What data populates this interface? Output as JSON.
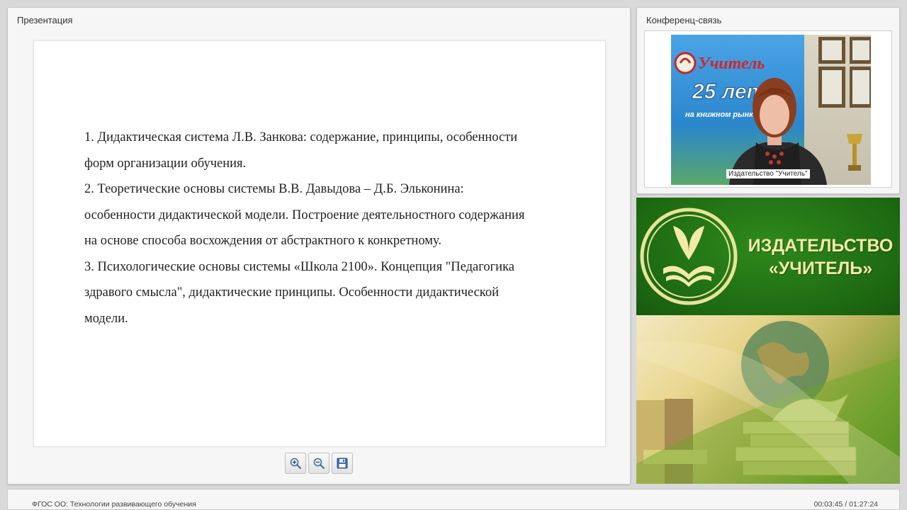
{
  "presentation": {
    "title": "Презентация",
    "slide": {
      "lines": [
        "1. Дидактическая система Л.В. Занкова: содержание, принципы, особенности",
        "форм организации обучения.",
        "2. Теоретические основы системы В.В. Давыдова – Д.Б. Эльконина:",
        "особенности дидактической модели. Построение деятельностного содержания",
        "на основе способа восхождения от абстрактного к конкретному.",
        "3. Психологические основы системы «Школа 2100». Концепция \"Педагогика",
        "здравого смысла\", дидактические принципы. Особенности дидактической",
        "модели."
      ]
    },
    "toolbar": {
      "zoom_in_icon": "zoom-in-icon",
      "zoom_out_icon": "zoom-out-icon",
      "save_icon": "floppy-disk-icon"
    }
  },
  "conference": {
    "title": "Конференц-связь",
    "speaker_label": "Издательство \"Учитель\"",
    "backdrop": {
      "logo_text": "Учитель",
      "years_text": "25 лет",
      "subtitle_text": "на книжном рынке России"
    }
  },
  "banner": {
    "publisher_line1": "ИЗДАТЕЛЬСТВО",
    "publisher_line2": "«УЧИТЕЛЬ»",
    "logo_icon": "book-emblem-icon",
    "colors": {
      "green": "#1e6a12",
      "gold": "#f3eaa8"
    }
  },
  "footer": {
    "course_title": "ФГОС ОО: Технологии развивающего обучения",
    "time": "00:03:45 / 01:27:24"
  }
}
